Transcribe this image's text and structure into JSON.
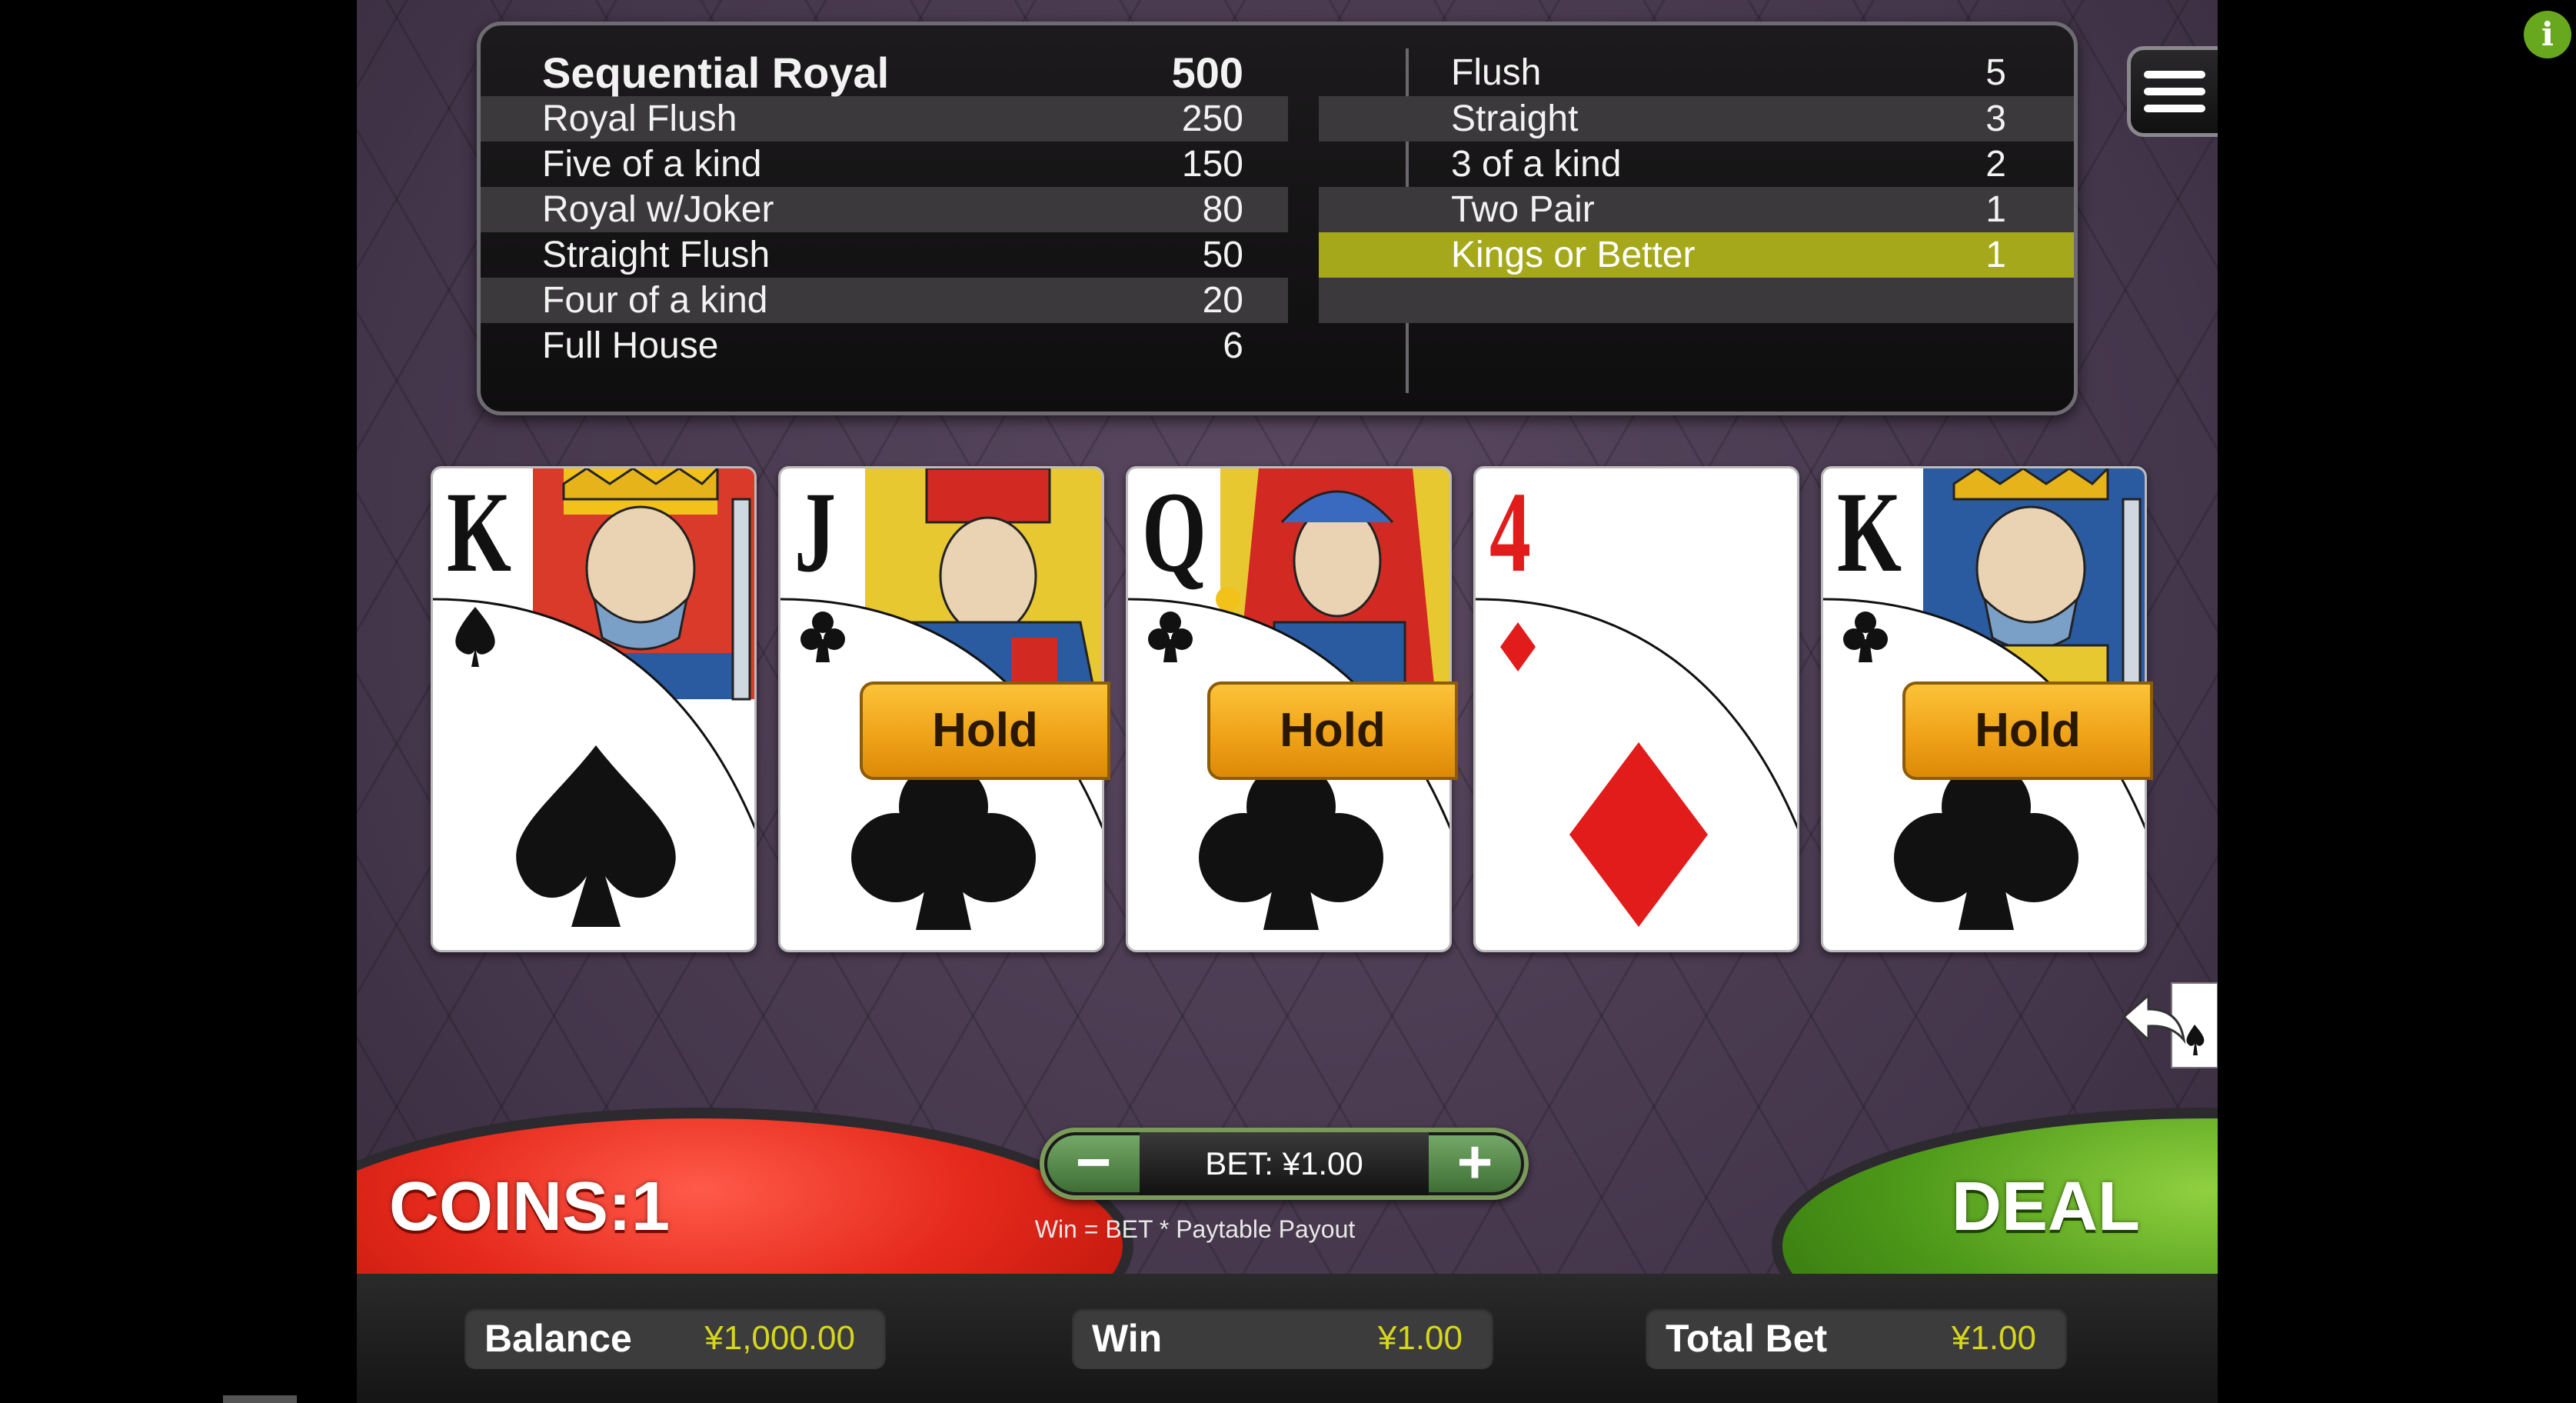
{
  "paytable": {
    "left": [
      {
        "hand": "Sequential Royal",
        "payout": "500"
      },
      {
        "hand": "Royal Flush",
        "payout": "250"
      },
      {
        "hand": "Five of a kind",
        "payout": "150"
      },
      {
        "hand": "Royal w/Joker",
        "payout": "80"
      },
      {
        "hand": "Straight Flush",
        "payout": "50"
      },
      {
        "hand": "Four of a kind",
        "payout": "20"
      },
      {
        "hand": "Full House",
        "payout": "6"
      }
    ],
    "right": [
      {
        "hand": "Flush",
        "payout": "5"
      },
      {
        "hand": "Straight",
        "payout": "3"
      },
      {
        "hand": "3 of a kind",
        "payout": "2"
      },
      {
        "hand": "Two Pair",
        "payout": "1"
      },
      {
        "hand": "Kings or Better",
        "payout": "1",
        "highlighted": true
      }
    ],
    "highlight_color": "#a4a81a"
  },
  "cards": [
    {
      "rank": "K",
      "suit": "spades",
      "suit_icon": "spade-icon",
      "held": false
    },
    {
      "rank": "J",
      "suit": "clubs",
      "suit_icon": "club-icon",
      "held": true
    },
    {
      "rank": "Q",
      "suit": "clubs",
      "suit_icon": "club-icon",
      "held": true
    },
    {
      "rank": "4",
      "suit": "diamonds",
      "suit_icon": "diamond-icon",
      "held": false
    },
    {
      "rank": "K",
      "suit": "clubs",
      "suit_icon": "club-icon",
      "held": true
    }
  ],
  "hold_label": "Hold",
  "coins_label": "COINS:1",
  "deal_label": "DEAL",
  "bet": {
    "minus": "−",
    "plus": "+",
    "value": "BET: ¥1.00"
  },
  "bet_note": "Win = BET * Paytable Payout",
  "bottom": {
    "balance_label": "Balance",
    "balance_value": "¥1,000.00",
    "win_label": "Win",
    "win_value": "¥1.00",
    "total_bet_label": "Total Bet",
    "total_bet_value": "¥1.00"
  },
  "info_label": "i",
  "colors": {
    "coins": "#e52a1c",
    "deal": "#4e9a1a",
    "hold": "#f0a318",
    "value_text": "#d6d61c"
  }
}
